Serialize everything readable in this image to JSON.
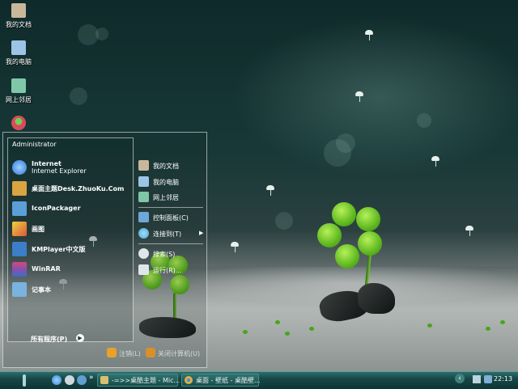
{
  "desktop": {
    "icons": [
      {
        "label": "我的文档",
        "icon": "my-documents-icon",
        "color": "#c9b79a"
      },
      {
        "label": "我的电脑",
        "icon": "my-computer-icon",
        "color": "#9cc4e6"
      },
      {
        "label": "网上邻居",
        "icon": "network-places-icon",
        "color": "#7fc7a8"
      },
      {
        "label": "",
        "icon": "recycle-plant-icon",
        "color": "#d94b5a"
      }
    ]
  },
  "start_menu": {
    "user_name": "Administrator",
    "programs": [
      {
        "title": "Internet",
        "subtitle": "Internet Explorer",
        "icon": "internet-explorer-icon",
        "color": "#2e78d6"
      },
      {
        "title": "桌面主题Desk.ZhuoKu.Com",
        "icon": "desktop-theme-icon",
        "color": "#d9a441"
      },
      {
        "title": "IconPackager",
        "icon": "iconpackager-icon",
        "color": "#5a9fd8"
      },
      {
        "title": "画图",
        "icon": "paint-icon",
        "color": "#d9583a"
      },
      {
        "title": "KMPlayer中文版",
        "icon": "kmplayer-icon",
        "color": "#3a7fc8"
      },
      {
        "title": "WinRAR",
        "icon": "winrar-icon",
        "color": "#8a4fb0"
      },
      {
        "title": "记事本",
        "icon": "notepad-icon",
        "color": "#7ab3e0"
      }
    ],
    "all_programs": "所有程序(P)",
    "places": [
      {
        "label": "我的文档",
        "icon": "my-documents-icon",
        "color": "#c9b79a"
      },
      {
        "label": "我的电脑",
        "icon": "my-computer-icon",
        "color": "#9cc4e6"
      },
      {
        "label": "网上邻居",
        "icon": "network-places-icon",
        "color": "#7fc7a8"
      },
      {
        "label": "控制面板(C)",
        "icon": "control-panel-icon",
        "color": "#6fa8d8"
      },
      {
        "label": "连接到(T)",
        "icon": "connect-to-icon",
        "color": "#4fa3d0",
        "has_arrow": true
      },
      {
        "label": "搜索(S)",
        "icon": "search-icon",
        "color": "#e0e6ea"
      },
      {
        "label": "运行(R)...",
        "icon": "run-icon",
        "color": "#dfe7ea"
      }
    ],
    "log_off": "注销(L)",
    "shut_down": "关闭计算机(U)"
  },
  "taskbar": {
    "quick_launch": [
      {
        "icon": "ie-quicklaunch-icon",
        "color": "#3a86d8"
      },
      {
        "icon": "show-desktop-icon",
        "color": "#cfd8dc"
      },
      {
        "icon": "media-player-icon",
        "color": "#5fa0d0"
      }
    ],
    "overflow": "»",
    "tasks": [
      {
        "label": "-=>>桌酷主题 - Mic...",
        "icon": "explorer-window-icon",
        "color": "#d8c070"
      },
      {
        "label": "桌面 - 壁纸 - 桌酷壁...",
        "icon": "chrome-window-icon",
        "color": "#e0b040"
      }
    ],
    "tray_arrow": "‹",
    "clock": "22:13"
  }
}
